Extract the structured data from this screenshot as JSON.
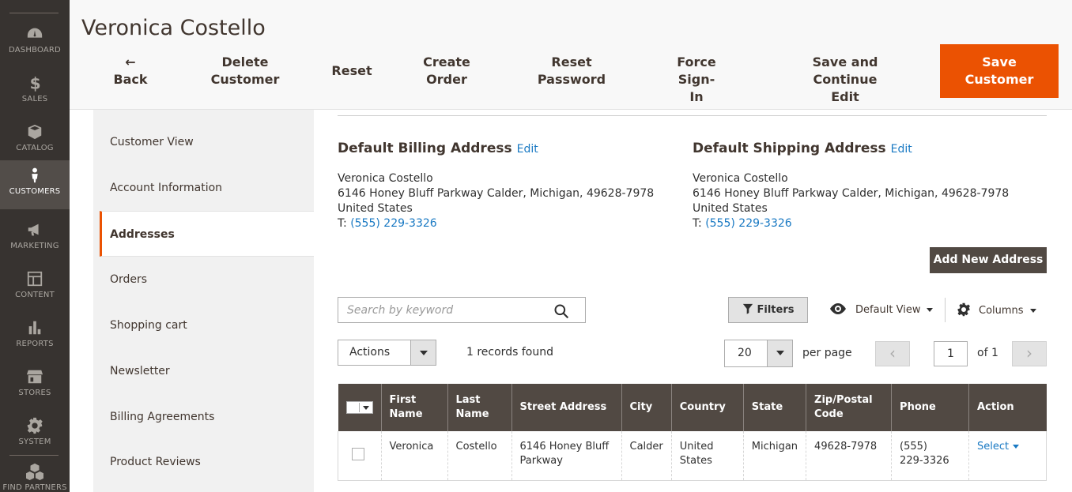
{
  "sidebar": {
    "items": [
      {
        "label": "DASHBOARD",
        "icon": "dashboard-icon"
      },
      {
        "label": "SALES",
        "icon": "dollar-icon"
      },
      {
        "label": "CATALOG",
        "icon": "box-icon"
      },
      {
        "label": "CUSTOMERS",
        "icon": "person-icon"
      },
      {
        "label": "MARKETING",
        "icon": "megaphone-icon"
      },
      {
        "label": "CONTENT",
        "icon": "layout-icon"
      },
      {
        "label": "REPORTS",
        "icon": "bar-chart-icon"
      },
      {
        "label": "STORES",
        "icon": "store-icon"
      },
      {
        "label": "SYSTEM",
        "icon": "gear-icon"
      },
      {
        "label": "FIND PARTNERS",
        "icon": "cubes-icon"
      }
    ]
  },
  "header": {
    "title": "Veronica Costello",
    "back_label": "Back",
    "back_arrow": "←",
    "delete_line1": "Delete",
    "delete_line2": "Customer",
    "reset_label": "Reset",
    "create_line1": "Create",
    "create_line2": "Order",
    "resetpw_line1": "Reset",
    "resetpw_line2": "Password",
    "force_line1": "Force Sign-",
    "force_line2": "In",
    "savecont_line1": "Save and Continue",
    "savecont_line2": "Edit",
    "save_line1": "Save",
    "save_line2": "Customer"
  },
  "tabs": [
    {
      "label": "Customer View"
    },
    {
      "label": "Account Information"
    },
    {
      "label": "Addresses"
    },
    {
      "label": "Orders"
    },
    {
      "label": "Shopping cart"
    },
    {
      "label": "Newsletter"
    },
    {
      "label": "Billing Agreements"
    },
    {
      "label": "Product Reviews"
    }
  ],
  "billing": {
    "title": "Default Billing Address",
    "edit": "Edit",
    "name": "Veronica Costello",
    "street": "6146 Honey Bluff Parkway Calder, Michigan, 49628-7978",
    "country": "United States",
    "phone_prefix": "T:",
    "phone": "(555) 229-3326"
  },
  "shipping": {
    "title": "Default Shipping Address",
    "edit": "Edit",
    "name": "Veronica Costello",
    "street": "6146 Honey Bluff Parkway Calder, Michigan, 49628-7978",
    "country": "United States",
    "phone_prefix": "T:",
    "phone": "(555) 229-3326"
  },
  "toolbar": {
    "add_address": "Add New Address",
    "search_placeholder": "Search by keyword",
    "filters": "Filters",
    "default_view": "Default View",
    "columns": "Columns",
    "actions": "Actions",
    "records_found": "1 records found",
    "per_page_value": "20",
    "per_page_label": "per page",
    "page_value": "1",
    "page_of": "of 1"
  },
  "grid": {
    "headers": {
      "first_name_1": "First",
      "first_name_2": "Name",
      "last_name_1": "Last",
      "last_name_2": "Name",
      "street": "Street Address",
      "city": "City",
      "country": "Country",
      "state": "State",
      "zip_1": "Zip/Postal",
      "zip_2": "Code",
      "phone": "Phone",
      "action": "Action"
    },
    "rows": [
      {
        "first": "Veronica",
        "last": "Costello",
        "street_1": "6146 Honey Bluff",
        "street_2": "Parkway",
        "city": "Calder",
        "country_1": "United",
        "country_2": "States",
        "state": "Michigan",
        "zip": "49628-7978",
        "phone_1": "(555)",
        "phone_2": "229-3326",
        "action": "Select"
      }
    ]
  },
  "colors": {
    "sidebar_bg": "#373330",
    "accent": "#eb5202",
    "link": "#1979c3",
    "grid_header": "#514943"
  }
}
